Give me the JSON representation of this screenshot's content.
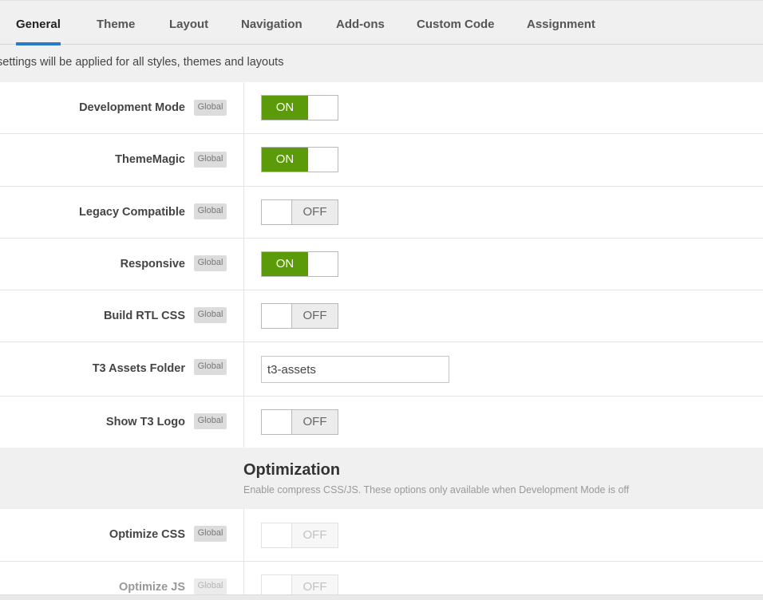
{
  "tabs": [
    {
      "label": "General",
      "active": true
    },
    {
      "label": "Theme"
    },
    {
      "label": "Layout"
    },
    {
      "label": "Navigation"
    },
    {
      "label": "Add-ons"
    },
    {
      "label": "Custom Code"
    },
    {
      "label": "Assignment"
    }
  ],
  "notice": "settings will be applied for all styles, themes and layouts",
  "badge_label": "Global",
  "toggle_labels": {
    "on": "ON",
    "off": "OFF"
  },
  "settings": [
    {
      "label": "Development Mode",
      "state": "ON"
    },
    {
      "label": "ThemeMagic",
      "state": "ON"
    },
    {
      "label": "Legacy Compatible",
      "state": "OFF"
    },
    {
      "label": "Responsive",
      "state": "ON"
    },
    {
      "label": "Build RTL CSS",
      "state": "OFF"
    },
    {
      "label": "T3 Assets Folder",
      "value": "t3-assets"
    },
    {
      "label": "Show T3 Logo",
      "state": "OFF"
    }
  ],
  "optimization": {
    "title": "Optimization",
    "description": "Enable compress CSS/JS. These options only available when Development Mode is off",
    "settings": [
      {
        "label": "Optimize CSS",
        "state": "OFF",
        "disabled": true
      },
      {
        "label": "Optimize JS",
        "state": "OFF",
        "disabled": true
      }
    ]
  },
  "colors": {
    "toggle_on": "#5b9a08",
    "active_tab": "#2b7cc6"
  }
}
